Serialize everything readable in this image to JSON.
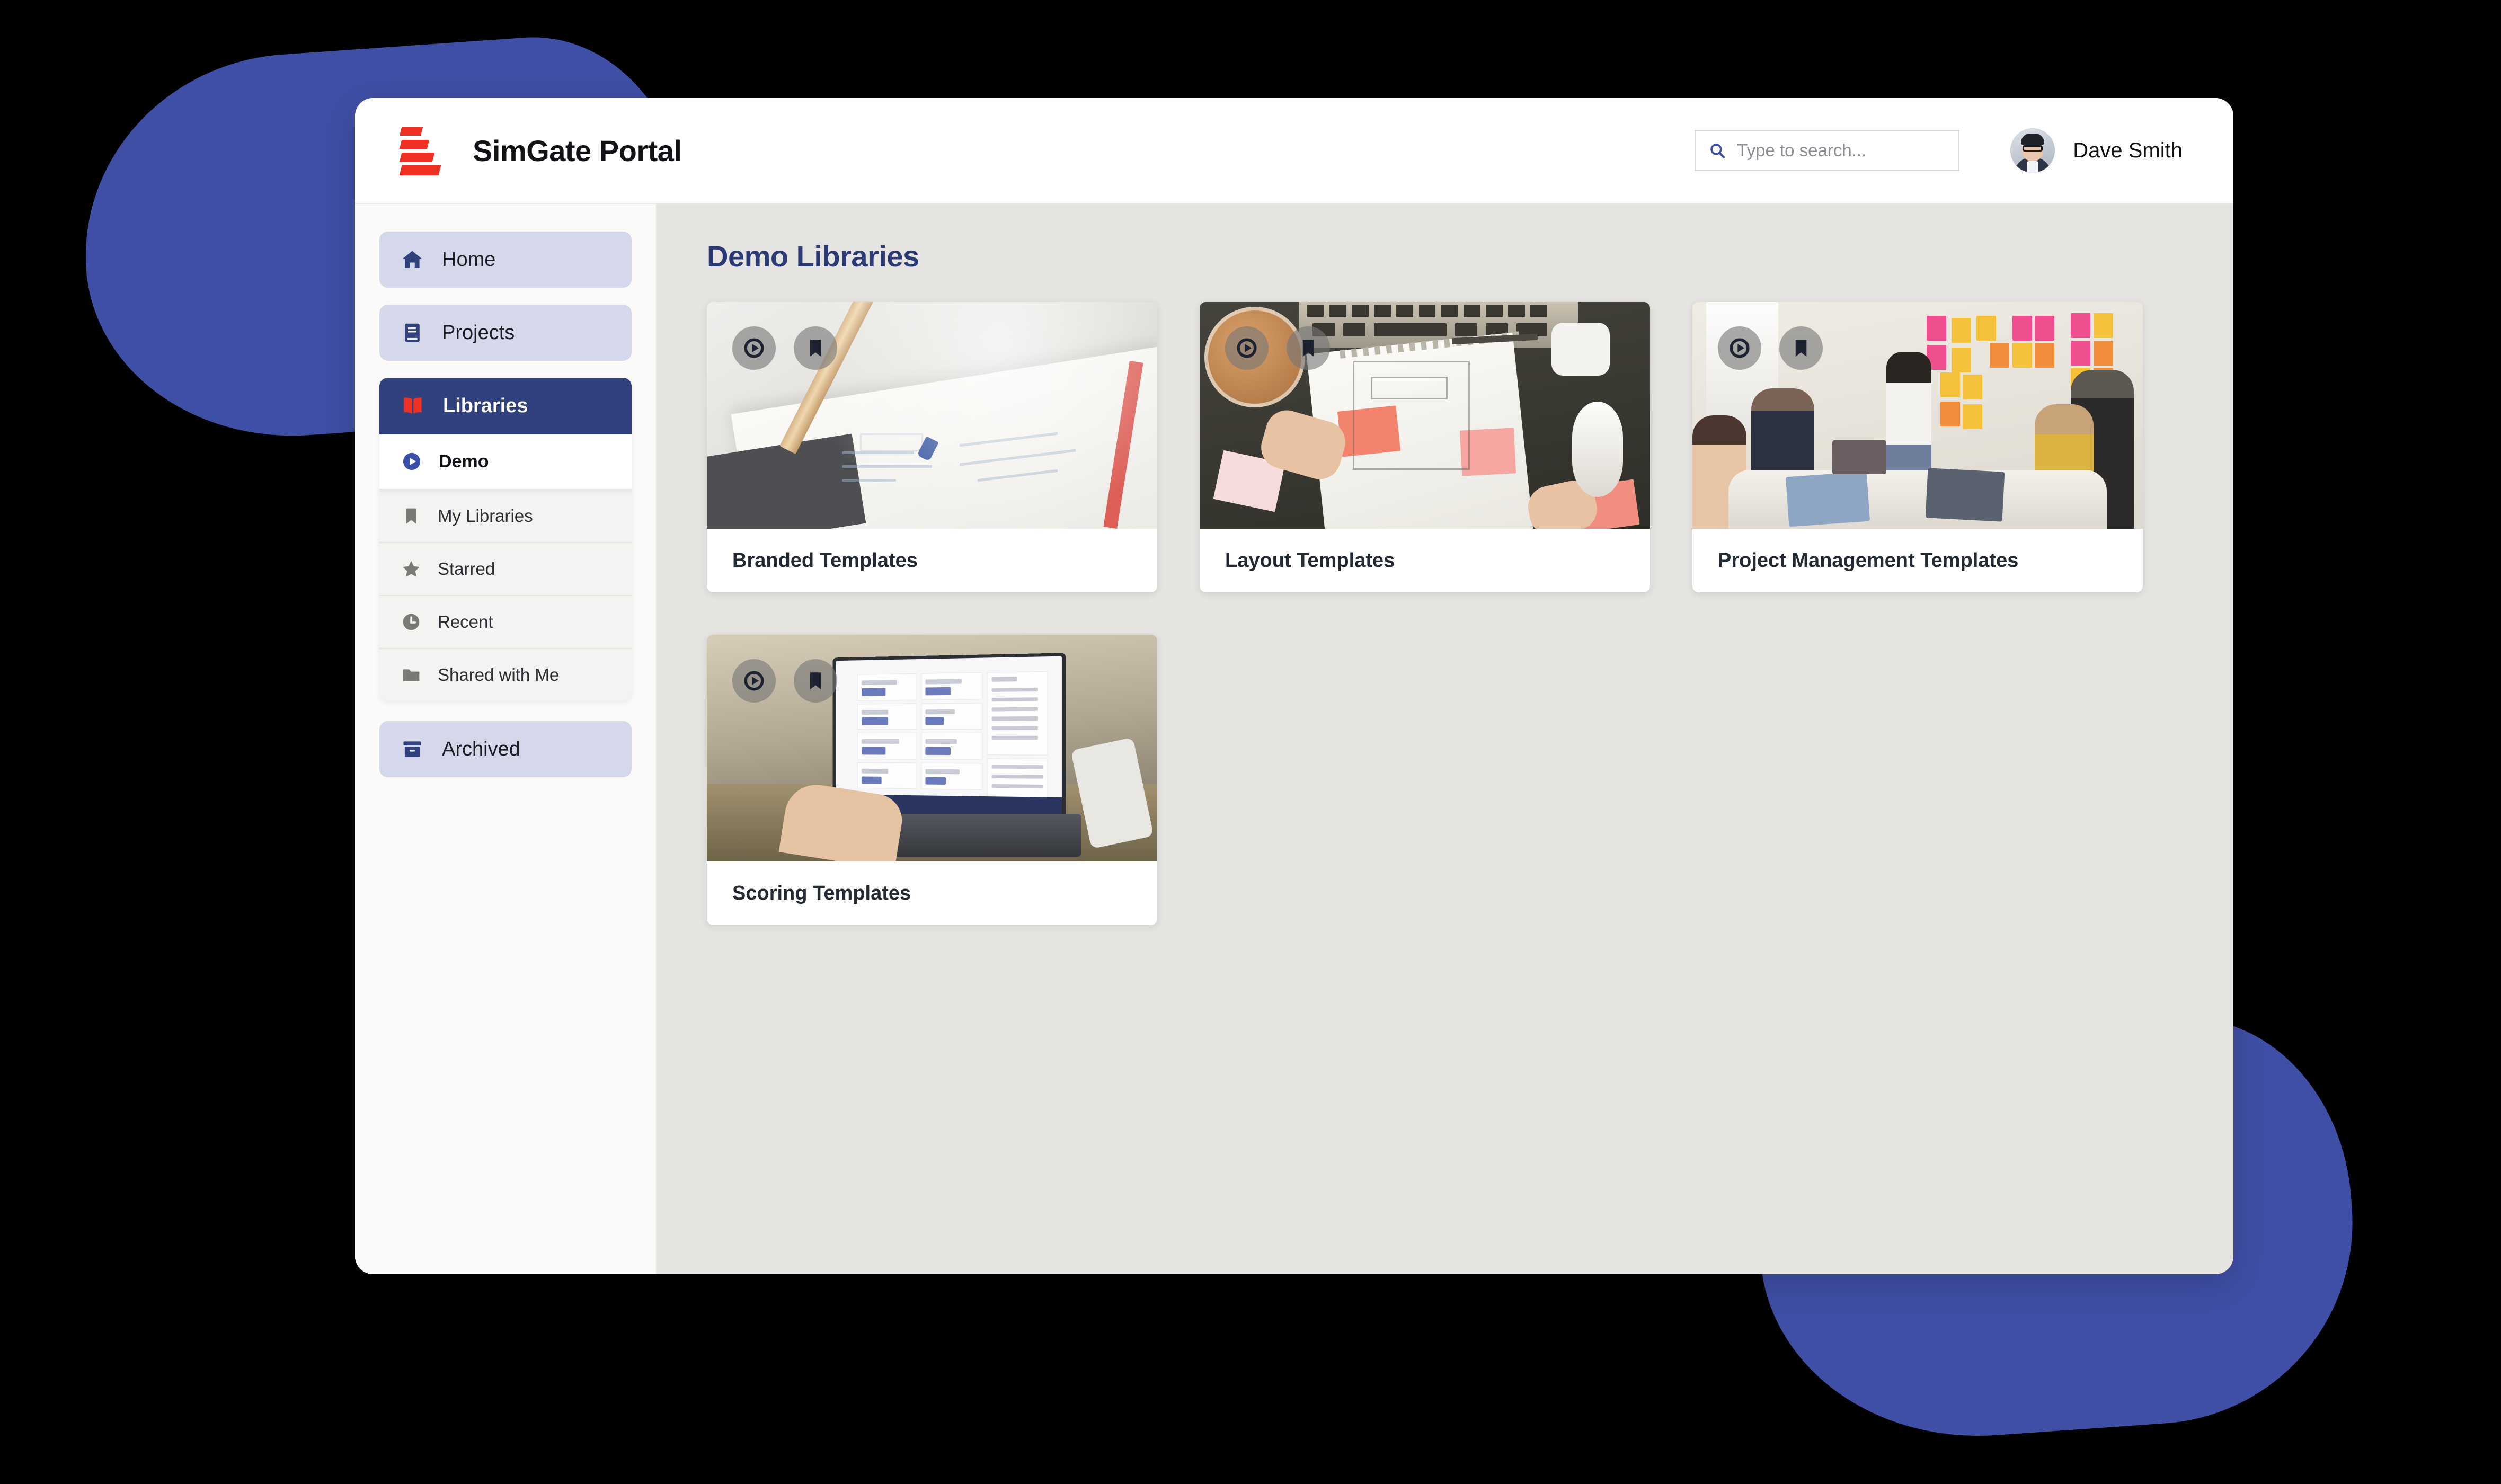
{
  "app": {
    "title": "SimGate Portal",
    "logo_icon": "stair-bars-logo",
    "logo_color": "#ef3124"
  },
  "header": {
    "search": {
      "placeholder": "Type to search...",
      "icon": "search-icon"
    },
    "user": {
      "name": "Dave Smith",
      "avatar_icon": "user-avatar"
    }
  },
  "sidebar": {
    "primary": [
      {
        "label": "Home",
        "icon": "home-icon"
      },
      {
        "label": "Projects",
        "icon": "book-icon"
      }
    ],
    "library_group": {
      "header": {
        "label": "Libraries",
        "icon": "open-book-icon"
      },
      "active": {
        "label": "Demo",
        "icon": "play-circle-icon"
      },
      "items": [
        {
          "label": "My Libraries",
          "icon": "bookmark-icon"
        },
        {
          "label": "Starred",
          "icon": "star-icon"
        },
        {
          "label": "Recent",
          "icon": "clock-icon"
        },
        {
          "label": "Shared with Me",
          "icon": "folder-icon"
        }
      ]
    },
    "archived": {
      "label": "Archived",
      "icon": "archive-box-icon"
    }
  },
  "main": {
    "page_title": "Demo Libraries",
    "cards": [
      {
        "title": "Branded Templates",
        "scene": "notebook-sketch",
        "play_icon": "play-icon",
        "bookmark_icon": "bookmark-icon"
      },
      {
        "title": "Layout Templates",
        "scene": "desk-wireframe",
        "play_icon": "play-icon",
        "bookmark_icon": "bookmark-icon"
      },
      {
        "title": "Project Management Templates",
        "scene": "workshop-stickies",
        "play_icon": "play-icon",
        "bookmark_icon": "bookmark-icon"
      },
      {
        "title": "Scoring Templates",
        "scene": "laptop-dashboard",
        "play_icon": "play-icon",
        "bookmark_icon": "bookmark-icon"
      }
    ]
  },
  "theme": {
    "brand_red": "#ef3124",
    "navy": "#31417e",
    "title_navy": "#2b3a74",
    "pill_lavender": "#d5d8ea",
    "page_bg": "#e6e4e1",
    "sidebar_bg": "#fbfaf8",
    "blob_blue": "#3f4fa5",
    "backdrop": "#000000"
  }
}
